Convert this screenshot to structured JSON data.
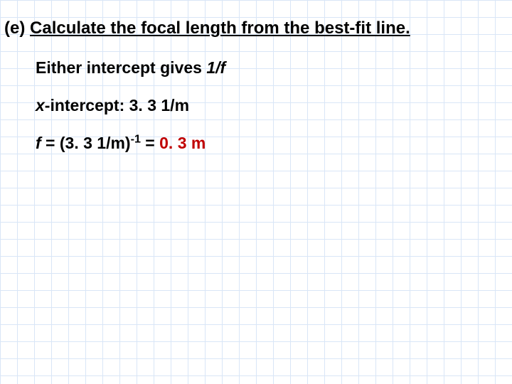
{
  "heading": {
    "part_label": "(e)",
    "part_text": "Calculate the focal length from the best-fit line."
  },
  "lines": {
    "intercept_note_prefix": "Either intercept gives ",
    "intercept_note_value": "1/f",
    "x_intercept_label": "x",
    "x_intercept_rest": "-intercept: 3. 3 1/m",
    "focal_var": "f",
    "focal_eq_lhs": " = (3. 3 1/m)",
    "focal_eq_exp": "-1",
    "focal_eq_eqs": " = ",
    "focal_answer": "0. 3 m"
  }
}
